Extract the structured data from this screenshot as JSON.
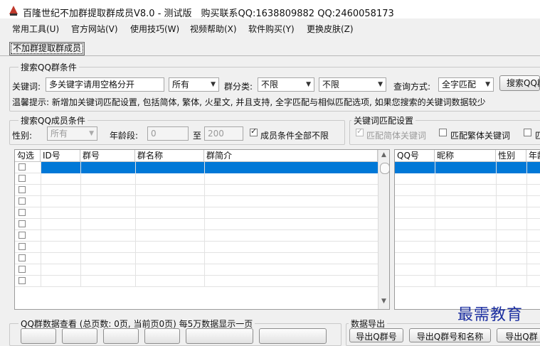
{
  "window": {
    "title": "百隆世纪不加群提取群成员V8.0 - 测试版　购买联系QQ:1638809882 QQ:2460058173"
  },
  "menu": [
    "常用工具(U)",
    "官方网站(V)",
    "使用技巧(W)",
    "视频帮助(X)",
    "软件购买(Y)",
    "更换皮肤(Z)"
  ],
  "tab": {
    "label": "不加群提取群成员"
  },
  "search_group": {
    "title": "搜索QQ群条件",
    "keyword_label": "关键词:",
    "keyword_value": "多关键字请用空格分开",
    "scope_value": "所有",
    "category_label": "群分类:",
    "category_value": "不限",
    "subcategory_value": "不限",
    "method_label": "查询方式:",
    "method_value": "全字匹配",
    "search_button": "搜索QQ群",
    "tip": "温馨提示: 新增加关键词匹配设置, 包括简体, 繁体, 火星文, 并且支持, 全字匹配与相似匹配选项, 如果您搜索的关键词数据较少"
  },
  "member_group": {
    "title": "搜索QQ成员条件",
    "gender_label": "性别:",
    "gender_value": "所有",
    "age_label": "年龄段:",
    "age_from": "0",
    "age_to_label": "至",
    "age_to": "200",
    "all_unlimited_label": "成员条件全部不限",
    "all_unlimited_checked": true
  },
  "keyword_match": {
    "title": "关键词匹配设置",
    "simplified_label": "匹配简体关键词",
    "simplified_checked": true,
    "traditional_label": "匹配繁体关键词",
    "traditional_checked": false,
    "third_label": "匹"
  },
  "group_table": {
    "columns": [
      "勾选",
      "ID号",
      "群号",
      "群名称",
      "群简介"
    ],
    "row_count": 11
  },
  "member_table": {
    "columns": [
      "QQ号",
      "昵称",
      "性别",
      "年龄"
    ],
    "row_count": 11
  },
  "bottom": {
    "group_view_title": "QQ群数据查看 (总页数: 0页, 当前页0页) 每5万数据显示一页",
    "export_title": "数据导出",
    "export_buttons": [
      "导出Q群号",
      "导出Q群号和名称",
      "导出Q群"
    ]
  },
  "watermark": "最需教育",
  "colors": {
    "selection": "#0078d7",
    "watermark": "#1c2fa0",
    "app_icon": "#c0392b"
  },
  "icons": {
    "app": "app-logo-icon",
    "dropdown": "chevron-down-icon",
    "scroll_up": "scroll-up-icon",
    "scroll_down": "scroll-down-icon"
  }
}
